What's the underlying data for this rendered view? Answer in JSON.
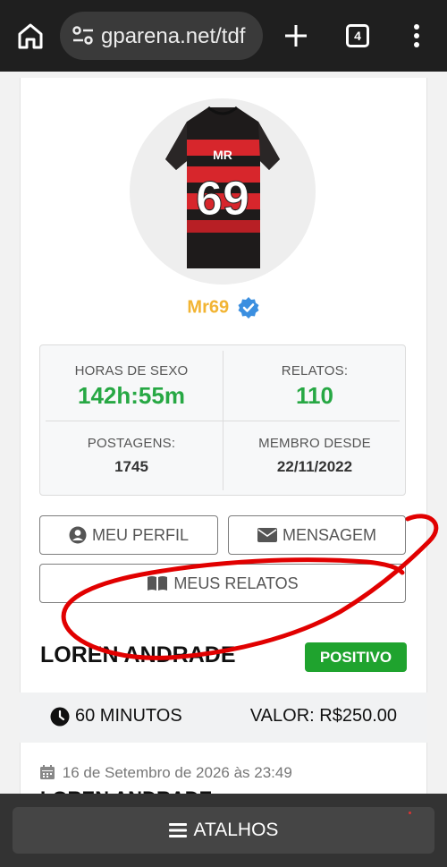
{
  "browser": {
    "url": "gparena.net/tdf",
    "tab_count": "4"
  },
  "profile": {
    "username": "Mr69",
    "jersey_name": "MR",
    "jersey_number": "69"
  },
  "stats": {
    "hours_label": "HORAS DE SEXO",
    "hours_value": "142h:55m",
    "reports_label": "RELATOS:",
    "reports_value": "110",
    "posts_label": "POSTAGENS:",
    "posts_value": "1745",
    "member_label": "MEMBRO DESDE",
    "member_value": "22/11/2022"
  },
  "buttons": {
    "profile": "MEU PERFIL",
    "message": "MENSAGEM",
    "my_reports": "MEUS RELATOS"
  },
  "report": {
    "title": "LOREN ANDRADE",
    "badge": "POSITIVO",
    "duration": "60 MINUTOS",
    "price": "VALOR: R$250.00",
    "date": "16 de Setembro de 2026 às 23:49",
    "subtitle": "LOREN ANDRADE"
  },
  "footer": {
    "shortcuts": "ATALHOS"
  },
  "colors": {
    "username": "#f2b433",
    "stat_green": "#27a844",
    "badge_green": "#1fa32e",
    "verified_blue": "#3b8fe0",
    "annotation_red": "#e10000"
  }
}
